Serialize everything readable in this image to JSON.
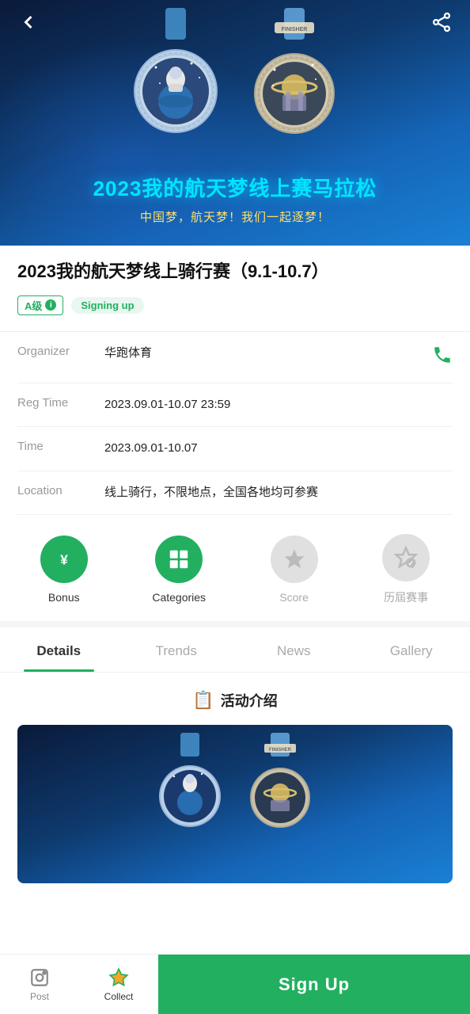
{
  "hero": {
    "title_zh": "2023我的航天梦线上赛马拉松",
    "subtitle_zh": "中国梦，航天梦！我们一起逐梦！",
    "alt": "2023 My Space Dream Online Marathon"
  },
  "nav": {
    "back_label": "back",
    "share_label": "share"
  },
  "event": {
    "title": "2023我的航天梦线上骑行赛（9.1-10.7）",
    "badge_level": "A级",
    "badge_status": "Signing up",
    "organizer_label": "Organizer",
    "organizer_value": "华跑体育",
    "reg_time_label": "Reg Time",
    "reg_time_value": "2023.09.01-10.07 23:59",
    "time_label": "Time",
    "time_value": "2023.09.01-10.07",
    "location_label": "Location",
    "location_value": "线上骑行，不限地点，全国各地均可参赛"
  },
  "icons": {
    "bonus_label": "Bonus",
    "categories_label": "Categories",
    "score_label": "Score",
    "history_label": "历屆赛事"
  },
  "tabs": [
    {
      "id": "details",
      "label": "Details",
      "active": true
    },
    {
      "id": "trends",
      "label": "Trends",
      "active": false
    },
    {
      "id": "news",
      "label": "News",
      "active": false
    },
    {
      "id": "gallery",
      "label": "Gallery",
      "active": false
    }
  ],
  "section": {
    "icon": "📋",
    "title": "活动介绍"
  },
  "bottom": {
    "post_label": "Post",
    "collect_label": "Collect",
    "signup_label": "Sign Up"
  }
}
